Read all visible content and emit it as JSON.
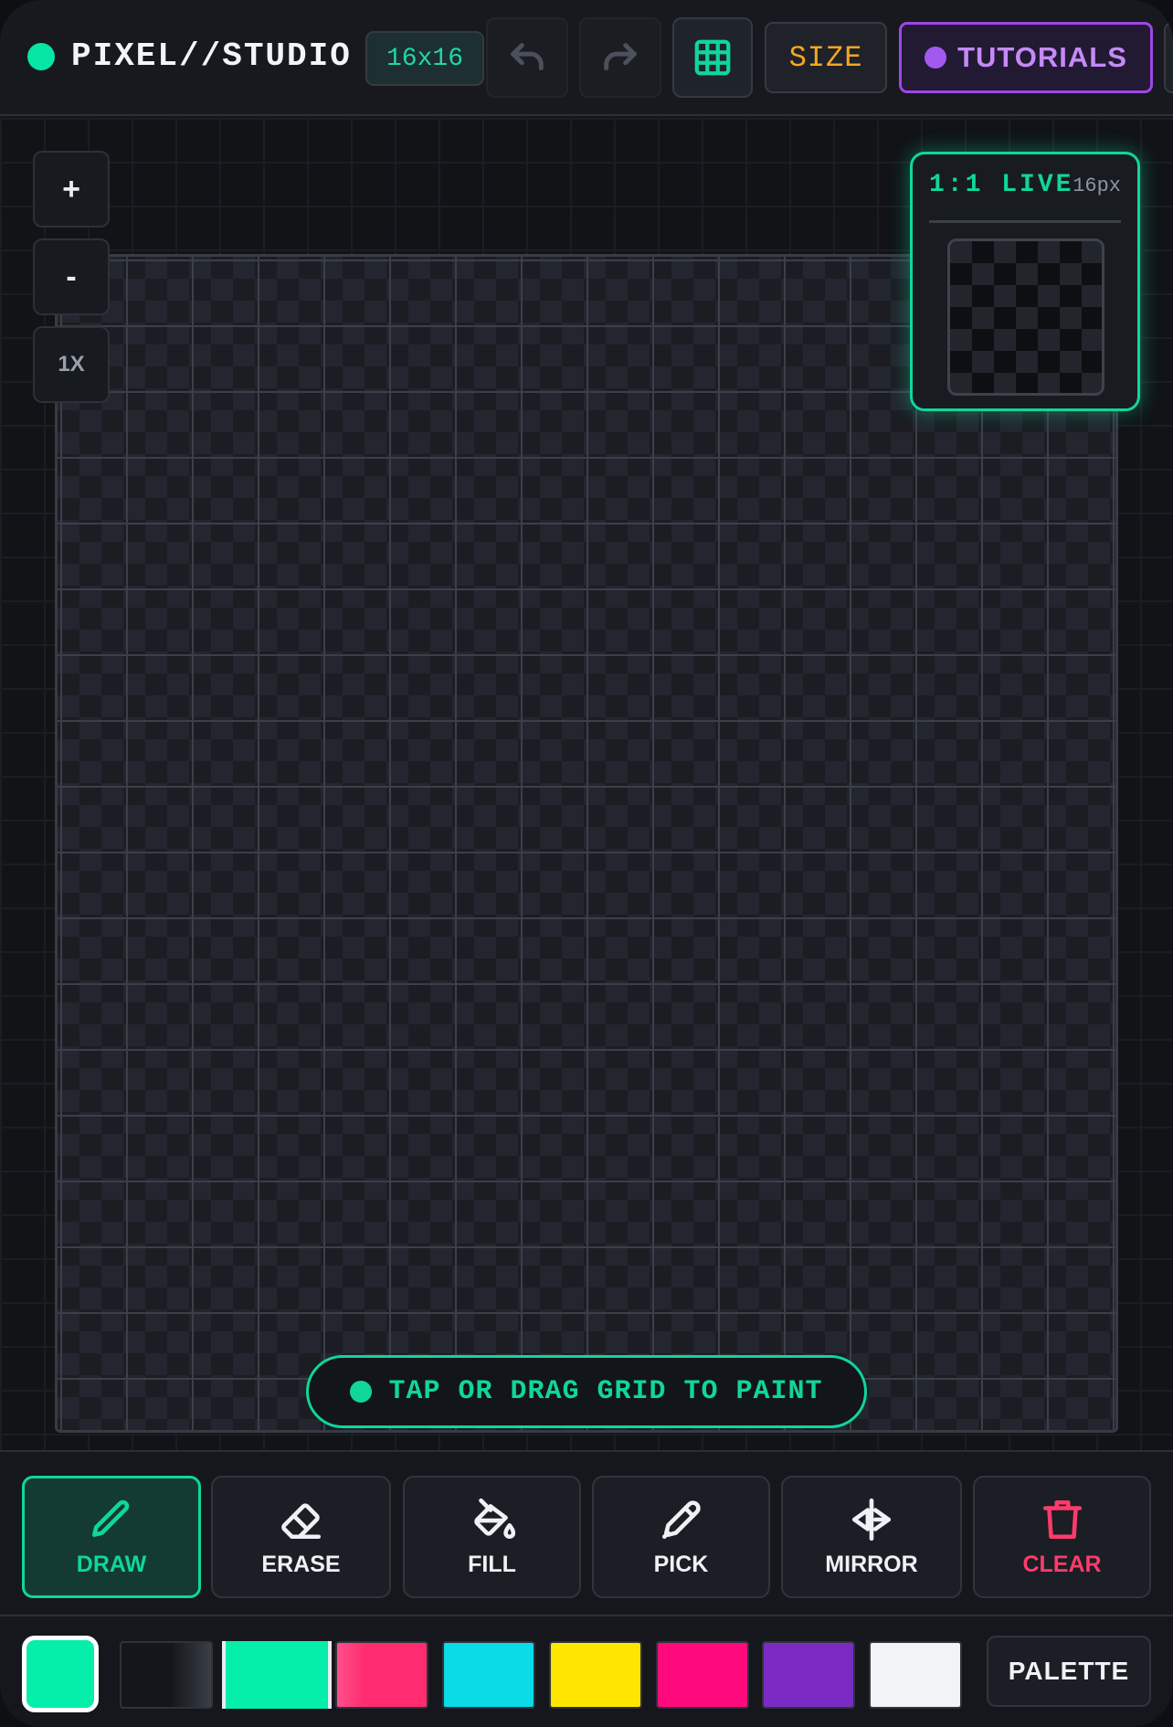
{
  "app": {
    "title": "PIXEL//STUDIO",
    "canvas_size": "16x16",
    "status_color": "#05e6a5"
  },
  "toolbar_top": {
    "undo_icon": "undo-icon",
    "redo_icon": "redo-icon",
    "grid_icon": "grid-icon",
    "size_label": "SIZE",
    "tutorials_label": "TUTORIALS"
  },
  "zoom": {
    "zoom_in_label": "+",
    "zoom_out_label": "-",
    "reset_label": "1X"
  },
  "preview": {
    "title": "1:1 LIVE",
    "size": "16px"
  },
  "hint": {
    "text": "TAP OR DRAG GRID TO PAINT"
  },
  "tools": [
    {
      "label": "DRAW",
      "icon": "pencil-icon",
      "active": true
    },
    {
      "label": "ERASE",
      "icon": "eraser-icon",
      "active": false
    },
    {
      "label": "FILL",
      "icon": "paint-bucket-icon",
      "active": false
    },
    {
      "label": "PICK",
      "icon": "eyedropper-icon",
      "active": false
    },
    {
      "label": "MIRROR",
      "icon": "mirror-icon",
      "active": false
    },
    {
      "label": "CLEAR",
      "icon": "trash-icon",
      "active": false
    }
  ],
  "palette": {
    "current_color": "#05eeaa",
    "swatches": [
      "#14161b",
      "#05eeaa",
      "#ff2d6f",
      "#0adbe6",
      "#ffe600",
      "#ff0a7c",
      "#7b2bc4",
      "#f1f3f7"
    ],
    "selected_index": 1,
    "button_label": "PALETTE"
  },
  "colors": {
    "accent": "#10d69c",
    "warning": "#f5a623",
    "purple": "#a259ef",
    "danger": "#ff3b6b"
  }
}
